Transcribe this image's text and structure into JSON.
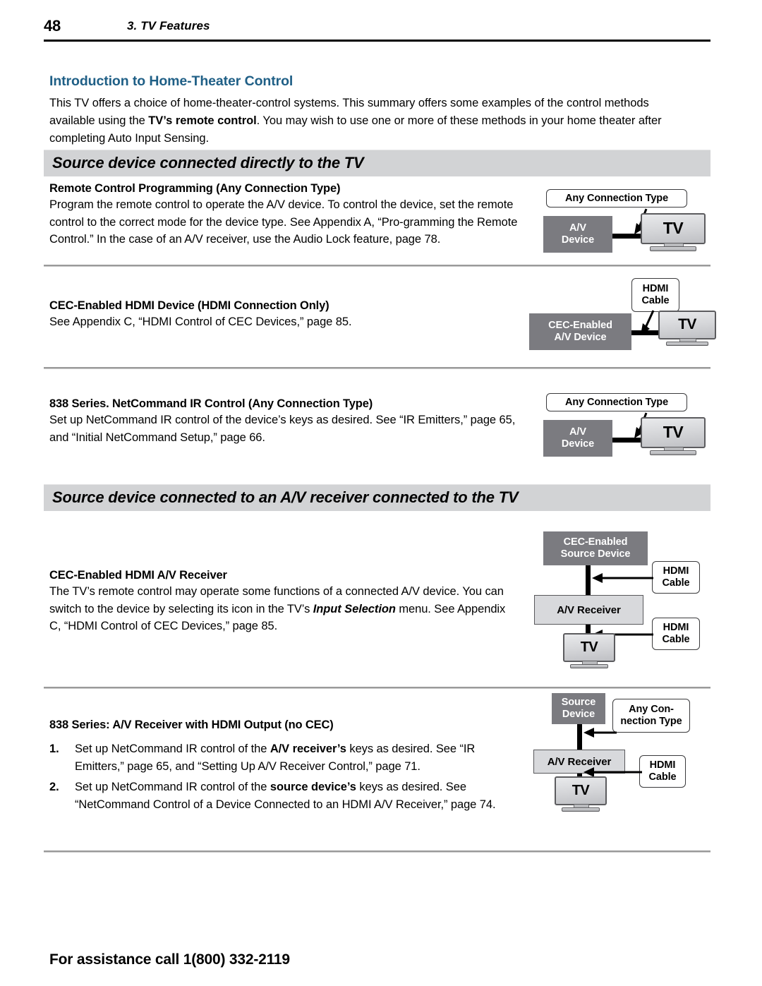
{
  "page": {
    "folio": "48",
    "chapter": "3.  TV Features",
    "footer": "For assistance call 1(800) 332-2119",
    "accent_color": "#1f5f86",
    "banner_color": "#d2d3d5",
    "device_dark_color": "#7b7b80",
    "device_light_color": "#d8d9dc"
  },
  "intro": {
    "title": "Introduction to Home-Theater Control",
    "paragraph_part1": "This TV offers a choice of home-theater-control systems. This summary offers some examples of the control methods available using the ",
    "paragraph_bold": "TV’s remote control",
    "paragraph_part2": ".  You may wish to use one or more of these methods in your home theater after completing Auto Input Sensing."
  },
  "sections": [
    {
      "banner": "Source device connected directly to the TV"
    },
    {
      "banner": "Source device connected to an A/V receiver connected to the TV"
    }
  ],
  "blocks": [
    {
      "heading": "Remote Control Programming (Any Connection Type)",
      "body": "Program the remote control to operate the A/V device.  To control the device, set the remote control to the correct mode for the device type.  See  Appendix A, “Pro-gramming the Remote Control.”  In the case of an A/V receiver, use the Audio Lock feature, page 78."
    },
    {
      "heading": "CEC-Enabled HDMI Device (HDMI Connection Only)",
      "body": "See Appendix C, “HDMI Control of CEC Devices,” page 85."
    },
    {
      "heading": "838 Series.  NetCommand IR Control (Any Connection Type)",
      "body": "Set up NetCommand IR control of the device’s keys as desired.  See “IR Emitters,” page 65, and “Initial NetCommand Setup,” page 66."
    },
    {
      "heading": "CEC-Enabled HDMI A/V Receiver",
      "body_part1": "The TV’s remote control may operate some functions of a connected A/V device. You can switch to the device by selecting its icon in the TV’s ",
      "body_italic": "Input Selection",
      "body_part2": " menu. See Appendix C, “HDMI Control of CEC Devices,” page 85."
    },
    {
      "heading": "838 Series:  A/V Receiver with HDMI Output (no CEC)",
      "steps": [
        {
          "num": "1.",
          "part1": "Set up NetCommand IR control of the ",
          "bold": "A/V receiver’s",
          "part2": " keys as desired.  See “IR Emitters,” page 65, and “Setting Up A/V Receiver Control,” page 71."
        },
        {
          "num": "2.",
          "part1": "Set up NetCommand IR control of the ",
          "bold": "source device’s",
          "part2": " keys as desired.  See “NetCommand Control of a Device Connected to an HDMI A/V Receiver,” page 74."
        }
      ]
    }
  ],
  "diagrams": [
    {
      "id": "diagram-remote-control",
      "callout": "Any Connection Type",
      "device": "A/V\nDevice",
      "device_line1": "A/V",
      "device_line2": "Device",
      "tv": "TV"
    },
    {
      "id": "diagram-cec-hdmi",
      "callout_line1": "HDMI",
      "callout_line2": "Cable",
      "device_line1": "CEC-Enabled",
      "device_line2": "A/V Device",
      "tv": "TV"
    },
    {
      "id": "diagram-netcommand-ir",
      "callout": "Any Connection Type",
      "device_line1": "A/V",
      "device_line2": "Device",
      "tv": "TV"
    },
    {
      "id": "diagram-cec-receiver",
      "source_line1": "CEC-Enabled",
      "source_line2": "Source Device",
      "receiver": "A/V Receiver",
      "callout_top_line1": "HDMI",
      "callout_top_line2": "Cable",
      "callout_bottom_line1": "HDMI",
      "callout_bottom_line2": "Cable",
      "tv": "TV"
    },
    {
      "id": "diagram-receiver-no-cec",
      "source_line1": "Source",
      "source_line2": "Device",
      "receiver": "A/V Receiver",
      "callout_top_line1": "Any Con-",
      "callout_top_line2": "nection Type",
      "callout_bottom_line1": "HDMI",
      "callout_bottom_line2": "Cable",
      "tv": "TV"
    }
  ]
}
